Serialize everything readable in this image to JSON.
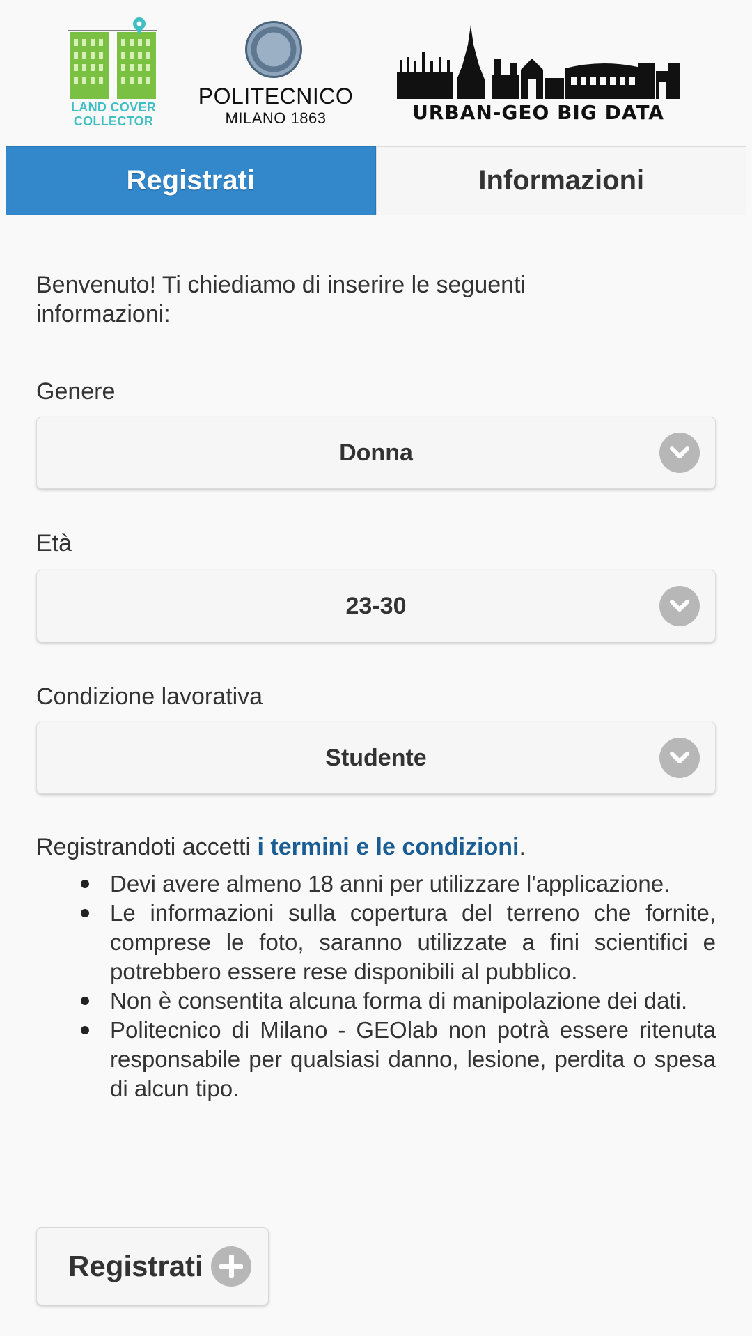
{
  "logos": {
    "land_cover": {
      "line1": "LAND COVER",
      "line2": "COLLECTOR",
      "color": "#3fbfc4",
      "building_color": "#7ac143"
    },
    "politecnico": {
      "title": "POLITECNICO",
      "subtitle": "MILANO 1863"
    },
    "urban_geo": {
      "text": "URBAN-GEO BIG DATA"
    }
  },
  "tabs": [
    {
      "label": "Registrati",
      "active": true
    },
    {
      "label": "Informazioni",
      "active": false
    }
  ],
  "intro": "Benvenuto! Ti chiediamo di inserire le seguenti informazioni:",
  "fields": {
    "genere": {
      "label": "Genere",
      "value": "Donna",
      "icon": "chevron-down-icon"
    },
    "eta": {
      "label": "Età",
      "value": "23-30",
      "icon": "chevron-down-icon"
    },
    "condizione": {
      "label": "Condizione lavorativa",
      "value": "Studente",
      "icon": "chevron-down-icon"
    }
  },
  "terms": {
    "prefix": "Registrandoti accetti ",
    "link": "i termini e le condizioni",
    "suffix": ".",
    "bullets": [
      "Devi avere almeno 18 anni per utilizzare l'applicazione.",
      "Le informazioni sulla copertura del terreno che fornite, comprese le foto, saranno utilizzate a fini scientifici e potrebbero essere rese disponibili al pubblico.",
      "Non è consentita alcuna forma di manipolazione dei dati.",
      "Politecnico di Milano - GEOlab non potrà essere ritenuta responsabile per qualsiasi danno, lesione, perdita o spesa di alcun tipo."
    ]
  },
  "register_button": {
    "label": "Registrati",
    "icon": "plus-icon"
  },
  "colors": {
    "accent": "#3388cc",
    "link": "#1a5c94",
    "icon_gray": "#b7b7b7"
  }
}
